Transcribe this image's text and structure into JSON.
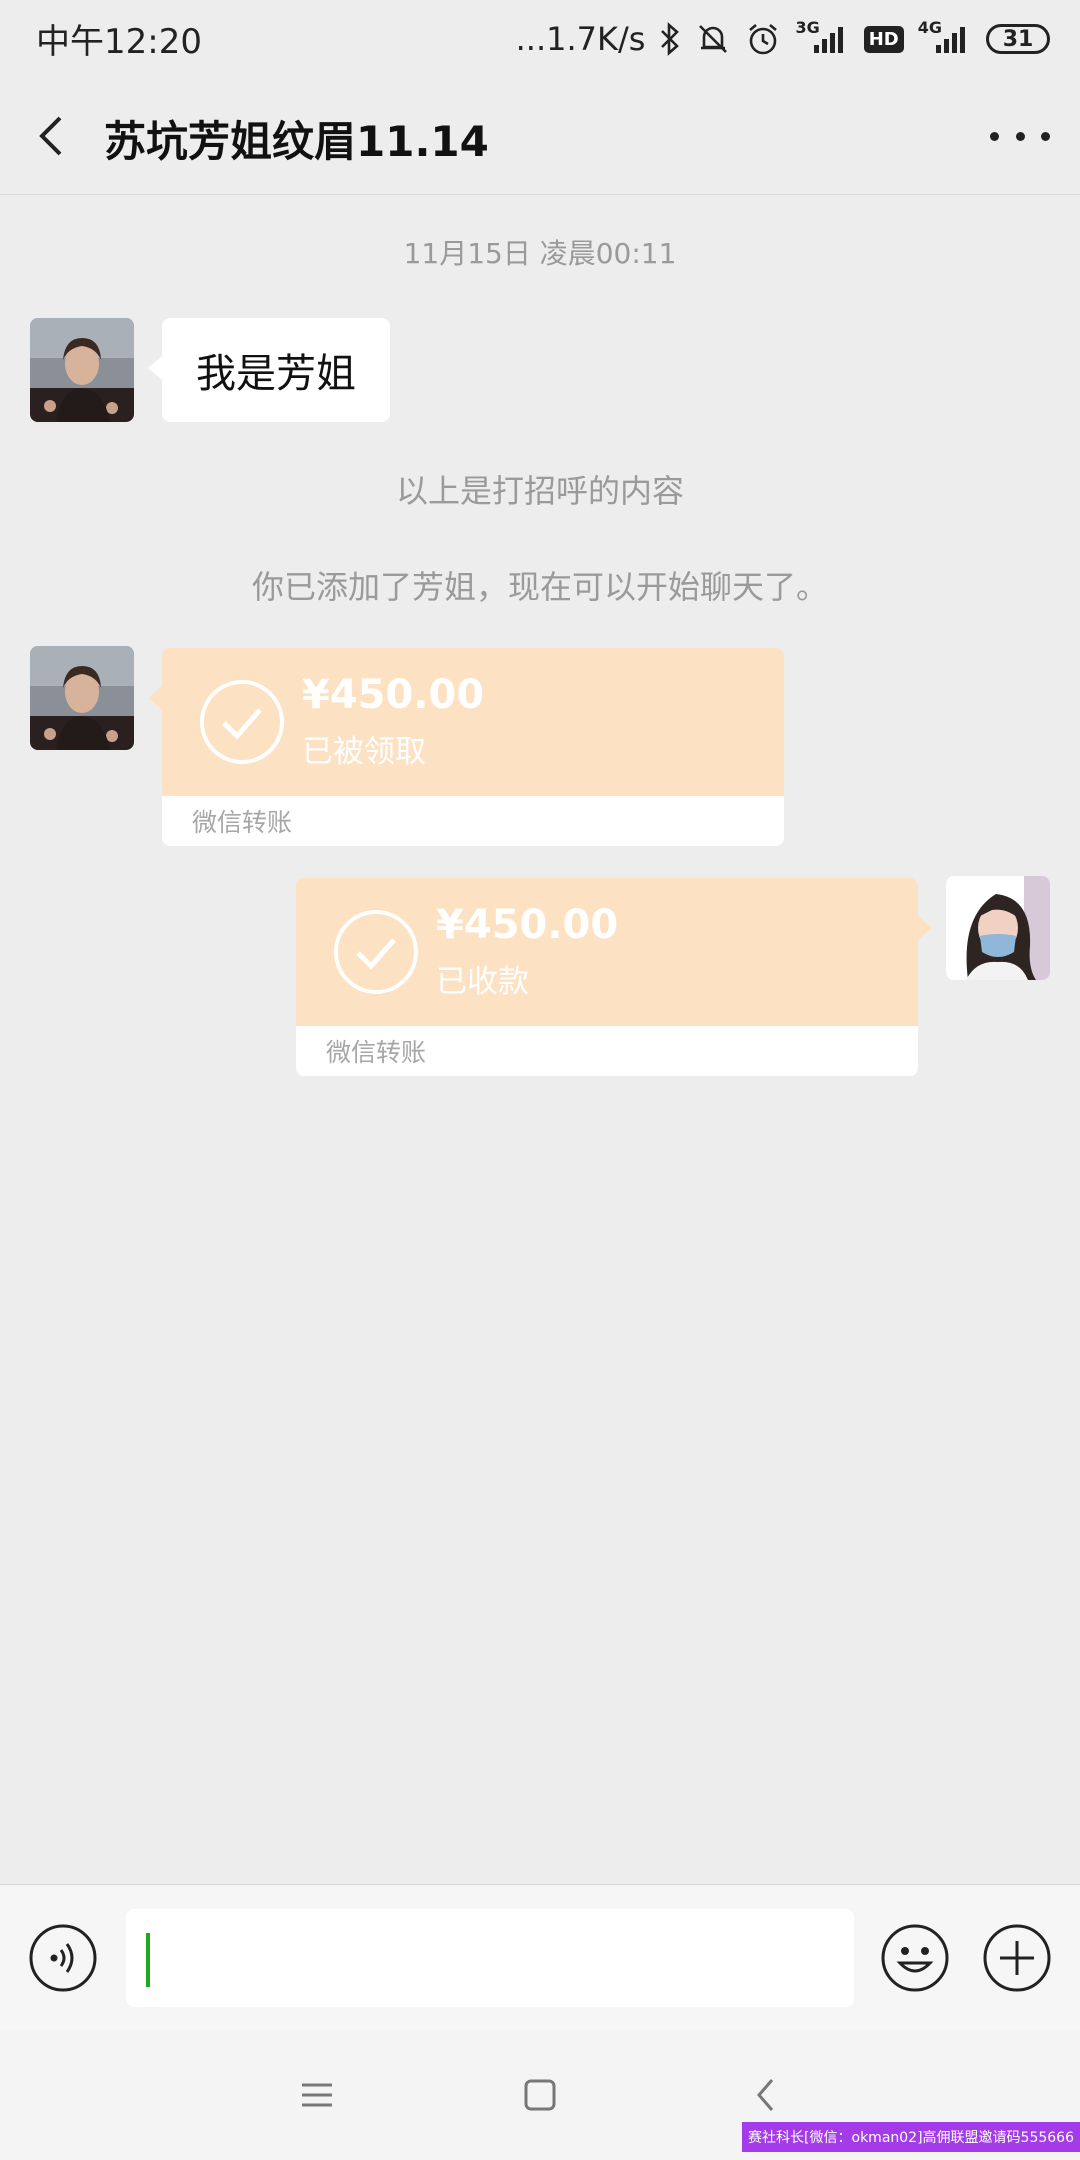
{
  "status_bar": {
    "time": "中午12:20",
    "speed": "...1.7K/s",
    "net_a": "3G",
    "hd": "HD",
    "net_b": "4G",
    "battery": "31"
  },
  "header": {
    "title": "苏坑芳姐纹眉11.14"
  },
  "chat": {
    "timestamp": "11月15日 凌晨00:11",
    "greeting_message": "我是芳姐",
    "system_messages": [
      "以上是打招呼的内容",
      "你已添加了芳姐，现在可以开始聊天了。"
    ],
    "transfers": [
      {
        "amount": "¥450.00",
        "status": "已被领取",
        "label": "微信转账",
        "side": "left"
      },
      {
        "amount": "¥450.00",
        "status": "已收款",
        "label": "微信转账",
        "side": "right"
      }
    ]
  },
  "input_bar": {
    "value": "",
    "voice_icon": "voice-icon",
    "emoji_icon": "emoji-icon",
    "plus_icon": "plus-icon"
  },
  "nav_bar": {
    "menu_icon": "menu-icon",
    "home_icon": "home-icon",
    "back_icon": "back-icon"
  },
  "watermark": "赛社科长[微信：okman02]高佣联盟邀请码555666",
  "colors": {
    "background": "#ededed",
    "transfer_card": "#fde1c3",
    "caret": "#1aad19"
  }
}
